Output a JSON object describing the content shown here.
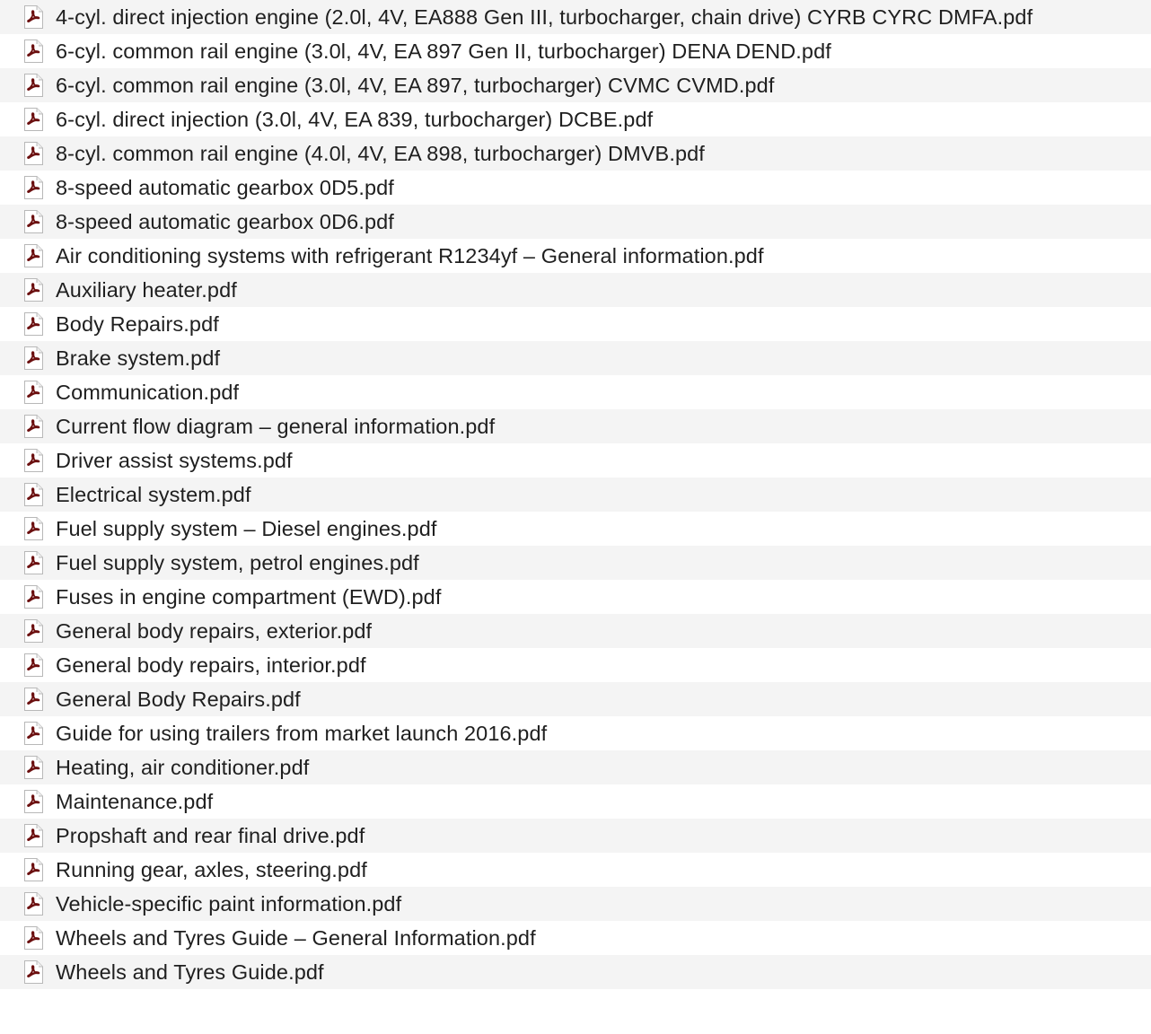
{
  "window": {
    "view": "file-list"
  },
  "files": [
    {
      "name": "4-cyl. direct injection engine (2.0l, 4V, EA888 Gen III, turbocharger, chain drive) CYRB CYRC DMFA.pdf",
      "icon": "pdf-file-icon"
    },
    {
      "name": "6-cyl. common rail engine (3.0l, 4V, EA 897 Gen II, turbocharger) DENA DEND.pdf",
      "icon": "pdf-file-icon"
    },
    {
      "name": "6-cyl. common rail engine (3.0l, 4V, EA 897, turbocharger) CVMC CVMD.pdf",
      "icon": "pdf-file-icon"
    },
    {
      "name": "6-cyl. direct injection (3.0l, 4V, EA 839, turbocharger) DCBE.pdf",
      "icon": "pdf-file-icon"
    },
    {
      "name": "8-cyl. common rail engine (4.0l, 4V, EA 898, turbocharger) DMVB.pdf",
      "icon": "pdf-file-icon"
    },
    {
      "name": "8-speed automatic gearbox 0D5.pdf",
      "icon": "pdf-file-icon"
    },
    {
      "name": "8-speed automatic gearbox 0D6.pdf",
      "icon": "pdf-file-icon"
    },
    {
      "name": "Air conditioning systems with refrigerant R1234yf – General information.pdf",
      "icon": "pdf-file-icon"
    },
    {
      "name": "Auxiliary heater.pdf",
      "icon": "pdf-file-icon"
    },
    {
      "name": "Body Repairs.pdf",
      "icon": "pdf-file-icon"
    },
    {
      "name": "Brake system.pdf",
      "icon": "pdf-file-icon"
    },
    {
      "name": "Communication.pdf",
      "icon": "pdf-file-icon"
    },
    {
      "name": "Current flow diagram – general information.pdf",
      "icon": "pdf-file-icon"
    },
    {
      "name": "Driver assist systems.pdf",
      "icon": "pdf-file-icon"
    },
    {
      "name": "Electrical system.pdf",
      "icon": "pdf-file-icon"
    },
    {
      "name": "Fuel supply system – Diesel engines.pdf",
      "icon": "pdf-file-icon"
    },
    {
      "name": "Fuel supply system, petrol engines.pdf",
      "icon": "pdf-file-icon"
    },
    {
      "name": "Fuses in engine compartment (EWD).pdf",
      "icon": "pdf-file-icon"
    },
    {
      "name": "General body repairs, exterior.pdf",
      "icon": "pdf-file-icon"
    },
    {
      "name": "General body repairs, interior.pdf",
      "icon": "pdf-file-icon"
    },
    {
      "name": "General Body Repairs.pdf",
      "icon": "pdf-file-icon"
    },
    {
      "name": "Guide for using trailers from market launch 2016.pdf",
      "icon": "pdf-file-icon"
    },
    {
      "name": "Heating, air conditioner.pdf",
      "icon": "pdf-file-icon"
    },
    {
      "name": "Maintenance.pdf",
      "icon": "pdf-file-icon"
    },
    {
      "name": "Propshaft and rear final drive.pdf",
      "icon": "pdf-file-icon"
    },
    {
      "name": "Running gear, axles, steering.pdf",
      "icon": "pdf-file-icon"
    },
    {
      "name": "Vehicle-specific paint information.pdf",
      "icon": "pdf-file-icon"
    },
    {
      "name": "Wheels and Tyres Guide – General Information.pdf",
      "icon": "pdf-file-icon"
    },
    {
      "name": "Wheels and Tyres Guide.pdf",
      "icon": "pdf-file-icon"
    }
  ],
  "empty_rows": 1,
  "colors": {
    "row_even": "#f4f4f4",
    "row_odd": "#ffffff",
    "pdf_icon_accent": "#6b0f0f",
    "text": "#1f1f1f"
  }
}
